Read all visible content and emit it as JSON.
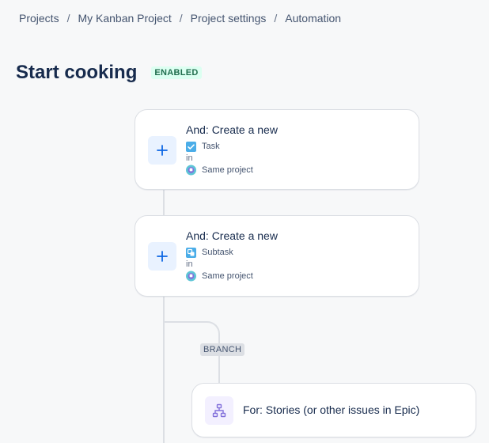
{
  "breadcrumb": {
    "items": [
      "Projects",
      "My Kanban Project",
      "Project settings",
      "Automation"
    ],
    "separator": "/"
  },
  "rule": {
    "title": "Start cooking",
    "status": "ENABLED"
  },
  "steps": [
    {
      "title": "And: Create a new",
      "issue_type": "Task",
      "in_label": "in",
      "project": "Same project",
      "icon": "plus-icon"
    },
    {
      "title": "And: Create a new",
      "issue_type": "Subtask",
      "in_label": "in",
      "project": "Same project",
      "icon": "plus-icon"
    }
  ],
  "branch": {
    "label": "BRANCH",
    "title": "For: Stories (or other issues in Epic)",
    "icon": "hierarchy-icon"
  },
  "colors": {
    "accent": "#0c66e4",
    "enabled_text": "#216e4e",
    "enabled_bg": "#dcfff1",
    "task": "#4bade8",
    "branch_icon": "#8270db"
  }
}
